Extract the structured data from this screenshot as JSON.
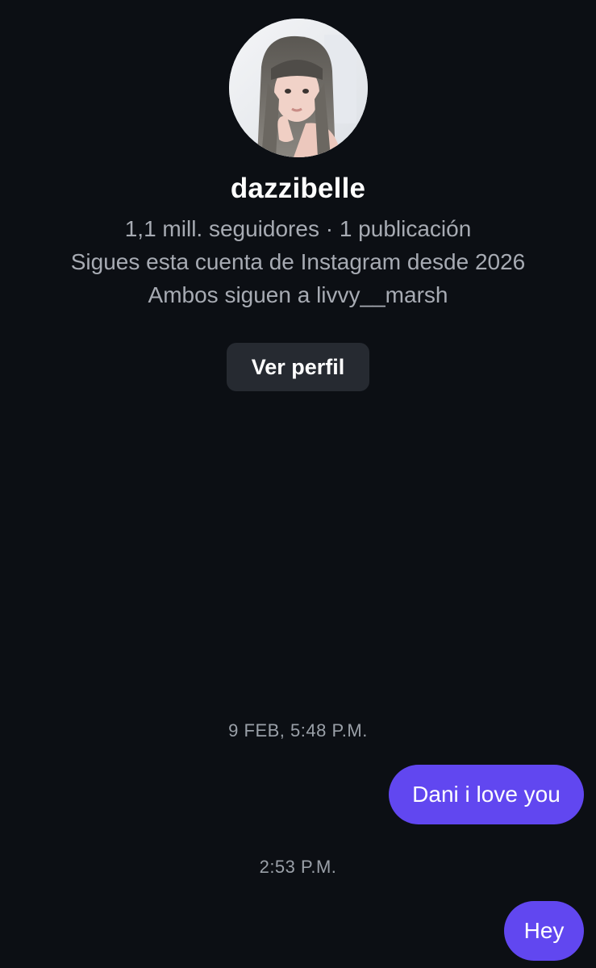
{
  "profile": {
    "username": "dazzibelle",
    "followers_line": "1,1 mill. seguidores · 1 publicación",
    "following_since": "Sigues esta cuenta de Instagram desde 2026",
    "mutual": "Ambos siguen a livvy__marsh",
    "view_profile_label": "Ver perfil"
  },
  "messages": [
    {
      "timestamp": "9 FEB, 5:48 P.M.",
      "text": "Dani i love you",
      "sender": "me"
    },
    {
      "timestamp": "2:53 P.M.",
      "text": "Hey",
      "sender": "me"
    }
  ],
  "colors": {
    "background": "#0c0f14",
    "bubble": "#6147f0",
    "button": "#262a31",
    "secondary_text": "#a7abb3"
  }
}
